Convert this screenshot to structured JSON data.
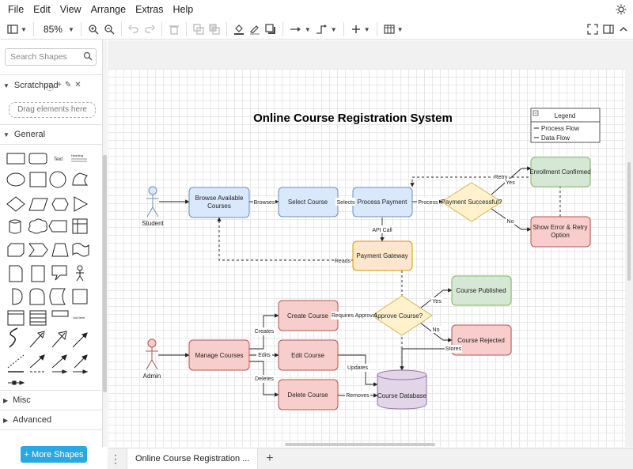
{
  "menu": [
    "File",
    "Edit",
    "View",
    "Arrange",
    "Extras",
    "Help"
  ],
  "toolbar": {
    "zoom": "85%"
  },
  "sidebar": {
    "search_placeholder": "Search Shapes",
    "scratchpad_title": "Scratchpad",
    "drag_hint": "Drag elements here",
    "general_title": "General",
    "misc_title": "Misc",
    "advanced_title": "Advanced",
    "more_shapes": "+ More Shapes",
    "shape_text_label": "Text",
    "shape_heading_label": "Heading",
    "shape_list_label": "List Item"
  },
  "tabs": [
    {
      "label": "Online Course Registration ..."
    }
  ],
  "diagram": {
    "title": "Online Course Registration System",
    "legend": {
      "title": "Legend",
      "items": [
        "Process Flow",
        "Data Flow"
      ]
    },
    "actors": {
      "student": "Student",
      "admin": "Admin"
    },
    "nodes": {
      "browse": "Browse Available Courses",
      "select": "Select Course",
      "process": "Process Payment",
      "payment_success": "Payment Successful?",
      "enroll": "Enrollment Confirmed",
      "error": "Show Error & Retry Option",
      "gateway": "Payment Gateway",
      "manage": "Manage Courses",
      "create": "Create Course",
      "edit": "Edit Course",
      "delete": "Delete Course",
      "approve": "Approve Course?",
      "published": "Course Published",
      "rejected": "Course Rejected",
      "database": "Course Database"
    },
    "edges": {
      "browses": "Browses",
      "selects": "Selects",
      "process": "Process",
      "yes1": "Yes",
      "no1": "No",
      "retry": "Retry",
      "api_call": "API Call",
      "reads": "Reads",
      "creates": "Creates",
      "edits": "Edits",
      "deletes": "Deletes",
      "requires_approval": "Requires Approval",
      "yes2": "Yes",
      "no2": "No",
      "stores": "Stores",
      "updates": "Updates",
      "removes": "Removes"
    },
    "colors": {
      "blue_fill": "#dae8fc",
      "blue_stroke": "#6c8ebf",
      "green_fill": "#d5e8d4",
      "green_stroke": "#82b366",
      "red_fill": "#f8cecc",
      "red_stroke": "#b85450",
      "yellow_fill": "#fff2cc",
      "yellow_stroke": "#d6b656",
      "orange_fill": "#ffe6cc",
      "orange_stroke": "#d79b00",
      "purple_fill": "#e1d5e7",
      "purple_stroke": "#9673a6"
    }
  }
}
